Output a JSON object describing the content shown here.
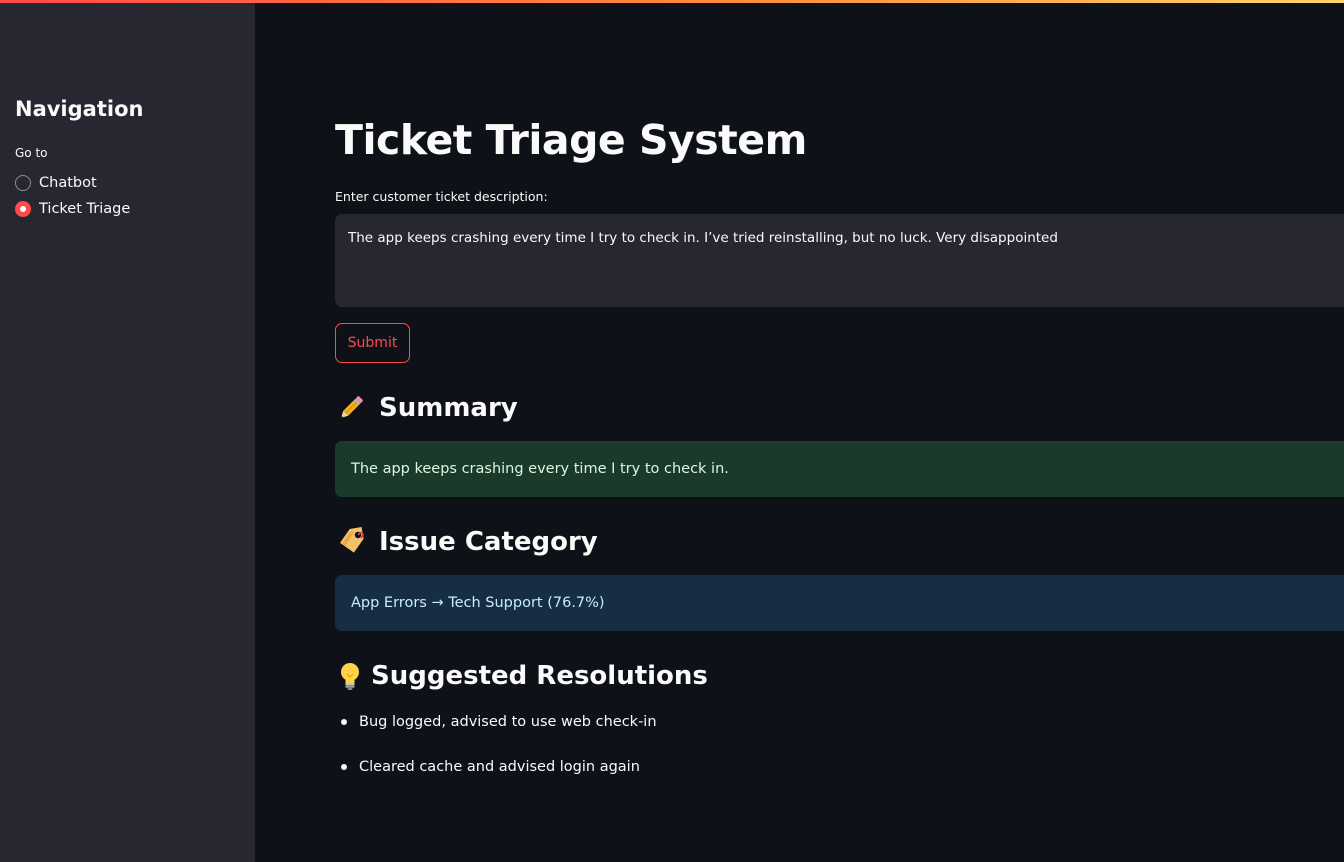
{
  "sidebar": {
    "title": "Navigation",
    "radio_label": "Go to",
    "options": [
      {
        "label": "Chatbot",
        "selected": false
      },
      {
        "label": "Ticket Triage",
        "selected": true
      }
    ]
  },
  "main": {
    "title": "Ticket Triage System",
    "input": {
      "label": "Enter customer ticket description:",
      "value": "The app keeps crashing every time I try to check in. I’ve tried reinstalling, but no luck. Very disappointed"
    },
    "submit_label": "Submit",
    "summary": {
      "heading": "Summary",
      "icon": "pencil-icon",
      "text": "The app keeps crashing every time I try to check in."
    },
    "category": {
      "heading": "Issue Category",
      "icon": "label-tag-icon",
      "text": "App Errors → Tech Support (76.7%)"
    },
    "resolutions": {
      "heading": "Suggested Resolutions",
      "icon": "light-bulb-icon",
      "items": [
        "Bug logged, advised to use web check-in",
        "Cleared cache and advised login again"
      ]
    }
  },
  "colors": {
    "primary": "#ff4b4b",
    "background": "#0e1117",
    "sidebar_background": "#262730",
    "success_background": "#1a3a2a",
    "info_background": "#172d43",
    "info_text": "#c7ebff"
  }
}
